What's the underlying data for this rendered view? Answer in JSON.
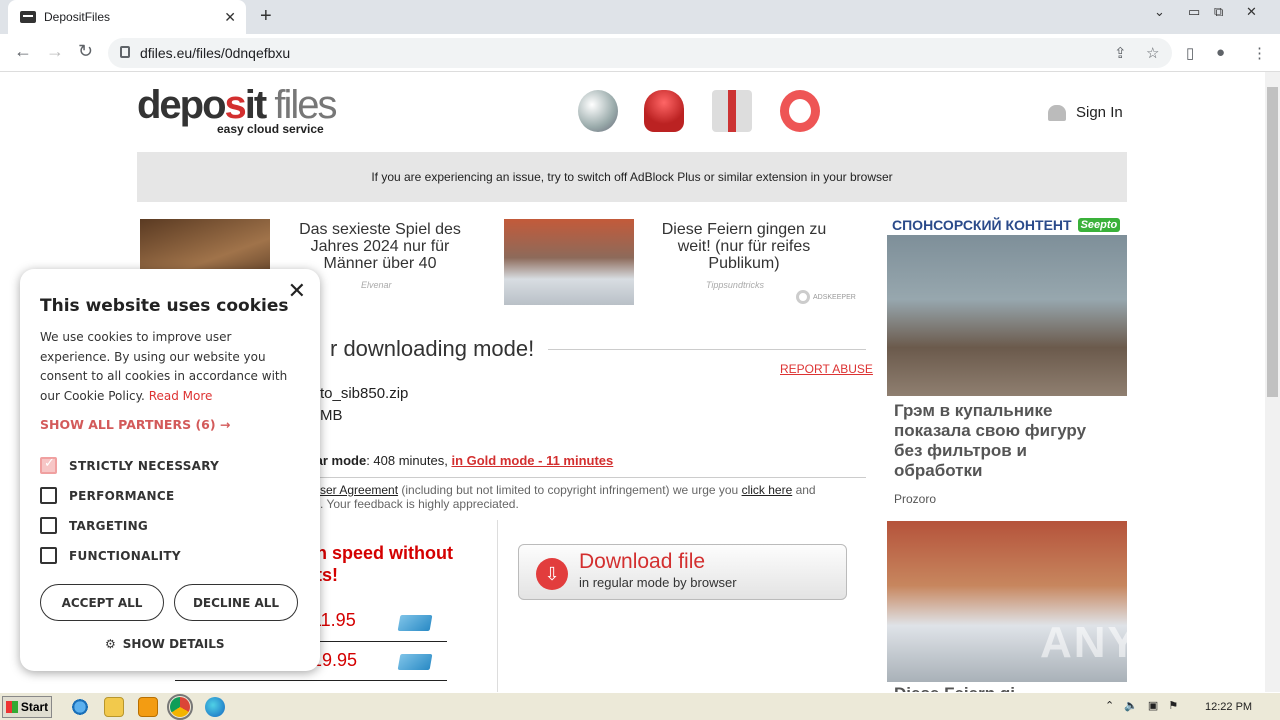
{
  "browser": {
    "tab_title": "DepositFiles",
    "url": "dfiles.eu/files/0dnqefbxu"
  },
  "header": {
    "logo_part1": "depo",
    "logo_part2": "s",
    "logo_part3": "it",
    "logo_part4": "files",
    "tagline": "easy cloud service",
    "sign_in": "Sign In"
  },
  "notice": "If you are experiencing an issue, try to switch off AdBlock Plus or similar extension in your browser",
  "ads": [
    {
      "title": "Das sexieste Spiel des Jahres 2024 nur für Männer über 40",
      "source": "Elvenar"
    },
    {
      "title": "Diese Feiern gingen zu weit! (nur für reifes Publikum)",
      "source": "Tippsundtricks"
    }
  ],
  "adskeeper": "ADSKEEPER",
  "download": {
    "title": "r downloading mode!",
    "report": "REPORT ABUSE",
    "filename": "to_sib850.zip",
    "filesize": "MB",
    "mode_label": "lar mode",
    "mode_value": ": 408 minutes, ",
    "gold_link": "in Gold mode - 11 minutes",
    "agreement_link": "ser Agreement",
    "agreement_text": " (including but not limited to copyright infringement) we urge you ",
    "click_here": "click here",
    "agreement_tail": " and",
    "feedback": ". Your feedback is highly appreciated.",
    "speed_line1": "n speed without",
    "speed_line2": "ts!",
    "price1": "11.95",
    "price2": "19.95",
    "button_title": "Download file",
    "button_sub": "in regular mode by browser"
  },
  "sponsor": {
    "label": "СПОНСОРСКИЙ КОНТЕНТ",
    "badge": "Seepto",
    "headline": "Грэм в купальнике показала свою фигуру без фильтров и обработки",
    "source": "Prozoro",
    "next_headline": "Diese Feiern gi"
  },
  "cookie": {
    "title": "This website uses cookies",
    "description": "We use cookies to improve user experience. By using our website you consent to all cookies in accordance with our Cookie Policy. ",
    "read_more": "Read More",
    "partners": "SHOW ALL PARTNERS (6) →",
    "options": [
      "STRICTLY NECESSARY",
      "PERFORMANCE",
      "TARGETING",
      "FUNCTIONALITY"
    ],
    "accept": "ACCEPT ALL",
    "decline": "DECLINE ALL",
    "details": "SHOW DETAILS"
  },
  "taskbar": {
    "start": "Start",
    "clock": "12:22 PM"
  },
  "watermark": "ANY RUN"
}
